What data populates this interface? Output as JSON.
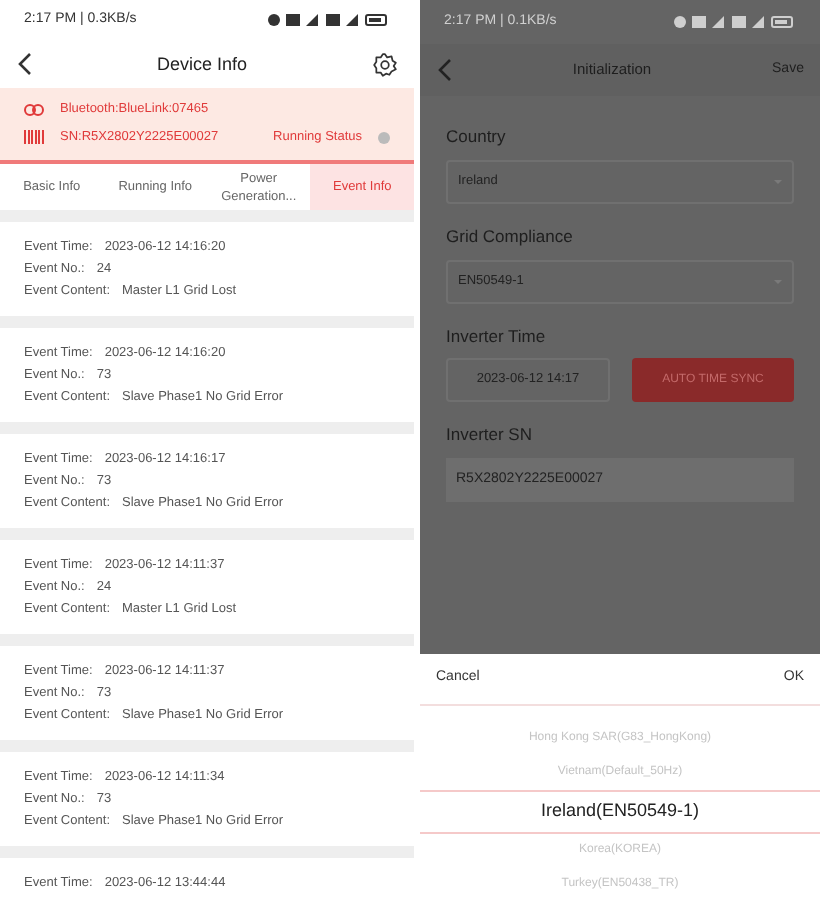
{
  "left": {
    "status_bar": {
      "time": "2:17 PM | 0.3KB/s"
    },
    "header": {
      "title": "Device Info"
    },
    "device": {
      "bluetooth": "Bluetooth:BlueLink:07465",
      "sn": "SN:R5X2802Y2225E00027",
      "status_label": "Running Status"
    },
    "tabs": [
      {
        "label": "Basic Info",
        "selected": false
      },
      {
        "label": "Running Info",
        "selected": false
      },
      {
        "label": "Power Generation...",
        "selected": false
      },
      {
        "label": "Event Info",
        "selected": true
      }
    ],
    "events": [
      {
        "time_label": "Event Time:",
        "time": "2023-06-12 14:16:20",
        "no_label": "Event No.:",
        "no": "24",
        "content_label": "Event Content:",
        "content": "Master L1 Grid Lost"
      },
      {
        "time_label": "Event Time:",
        "time": "2023-06-12 14:16:20",
        "no_label": "Event No.:",
        "no": "73",
        "content_label": "Event Content:",
        "content": "Slave Phase1 No Grid Error"
      },
      {
        "time_label": "Event Time:",
        "time": "2023-06-12 14:16:17",
        "no_label": "Event No.:",
        "no": "73",
        "content_label": "Event Content:",
        "content": "Slave Phase1 No Grid Error"
      },
      {
        "time_label": "Event Time:",
        "time": "2023-06-12 14:11:37",
        "no_label": "Event No.:",
        "no": "24",
        "content_label": "Event Content:",
        "content": "Master L1 Grid Lost"
      },
      {
        "time_label": "Event Time:",
        "time": "2023-06-12 14:11:37",
        "no_label": "Event No.:",
        "no": "73",
        "content_label": "Event Content:",
        "content": "Slave Phase1 No Grid Error"
      },
      {
        "time_label": "Event Time:",
        "time": "2023-06-12 14:11:34",
        "no_label": "Event No.:",
        "no": "73",
        "content_label": "Event Content:",
        "content": "Slave Phase1 No Grid Error"
      },
      {
        "time_label": "Event Time:",
        "time": "2023-06-12 13:44:44"
      }
    ]
  },
  "right": {
    "status_bar": {
      "time": "2:17 PM | 0.1KB/s"
    },
    "header": {
      "title": "Initialization",
      "action": "Save"
    },
    "country": {
      "label": "Country",
      "value": "Ireland"
    },
    "grid_compliance": {
      "label": "Grid Compliance",
      "value": "EN50549-1"
    },
    "inverter_time": {
      "label": "Inverter Time",
      "value": "2023-06-12 14:17",
      "button": "AUTO TIME SYNC"
    },
    "inverter_sn": {
      "label": "Inverter SN",
      "value": "R5X2802Y2225E00027"
    },
    "picker": {
      "cancel": "Cancel",
      "ok": "OK",
      "options": [
        {
          "label": "Hong Kong SAR(G83_HongKong)",
          "selected": false
        },
        {
          "label": "Vietnam(Default_50Hz)",
          "selected": false
        },
        {
          "label": "Ireland(EN50549-1)",
          "selected": true
        },
        {
          "label": "Korea(KOREA)",
          "selected": false
        },
        {
          "label": "Turkey(EN50438_TR)",
          "selected": false
        }
      ]
    }
  }
}
